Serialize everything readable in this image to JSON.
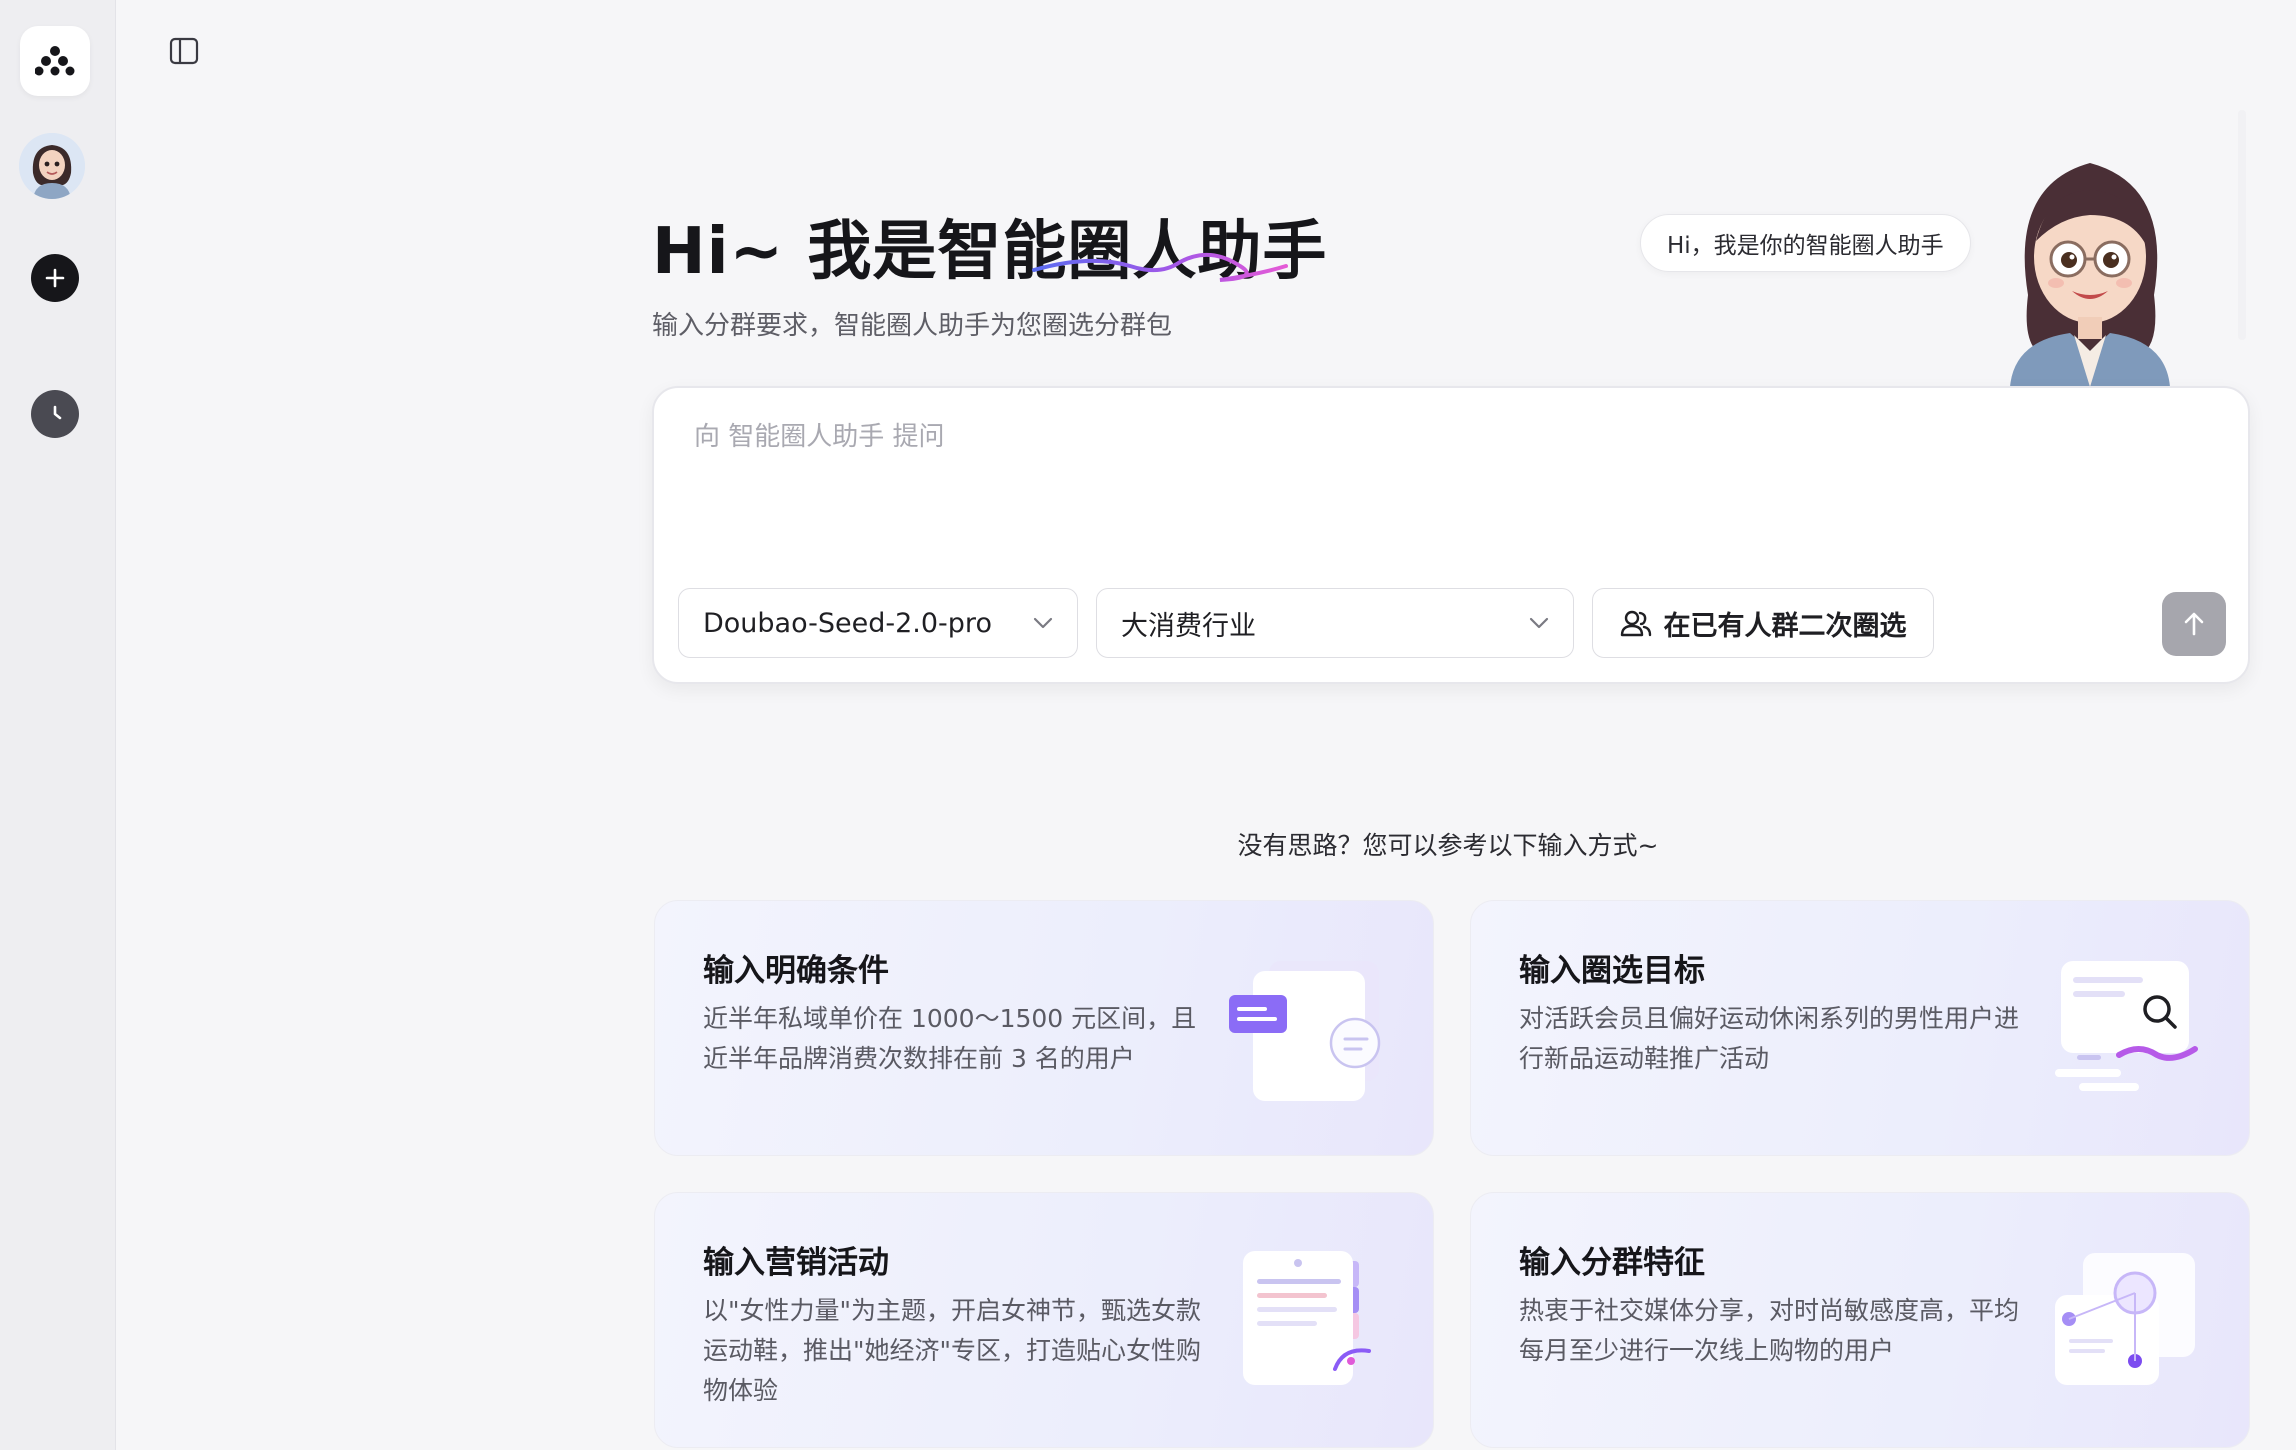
{
  "sidebar": {
    "logo_icon": "app-logo-icon",
    "avatar_icon": "assistant-avatar-icon",
    "new_chat_icon": "plus-icon",
    "history_icon": "clock-icon"
  },
  "header": {
    "toggle_icon": "sidebar-toggle-icon"
  },
  "hero": {
    "title": "Hi~ 我是智能圈人助手",
    "subtitle": "输入分群要求，智能圈人助手为您圈选分群包",
    "bubble": "Hi，我是你的智能圈人助手"
  },
  "composer": {
    "placeholder": "向 智能圈人助手 提问",
    "model_select": "Doubao-Seed-2.0-pro",
    "industry_select": "大消费行业",
    "filter_button": "在已有人群二次圈选",
    "send_icon": "arrow-up-icon"
  },
  "suggestions": {
    "hint": "没有思路？您可以参考以下输入方式~",
    "cards": [
      {
        "title": "输入明确条件",
        "desc": "近半年私域单价在 1000～1500 元区间，且近半年品牌消费次数排在前 3 名的用户"
      },
      {
        "title": "输入圈选目标",
        "desc": "对活跃会员且偏好运动休闲系列的男性用户进行新品运动鞋推广活动"
      },
      {
        "title": "输入营销活动",
        "desc": "以\"女性力量\"为主题，开启女神节，甄选女款运动鞋，推出\"她经济\"专区，打造贴心女性购物体验"
      },
      {
        "title": "输入分群特征",
        "desc": "热衷于社交媒体分享，对时尚敏感度高，平均每月至少进行一次线上购物的用户"
      }
    ]
  },
  "colors": {
    "accent_purple": "#8b5cf6",
    "accent_pink": "#e05ad8",
    "dark": "#16161a"
  }
}
